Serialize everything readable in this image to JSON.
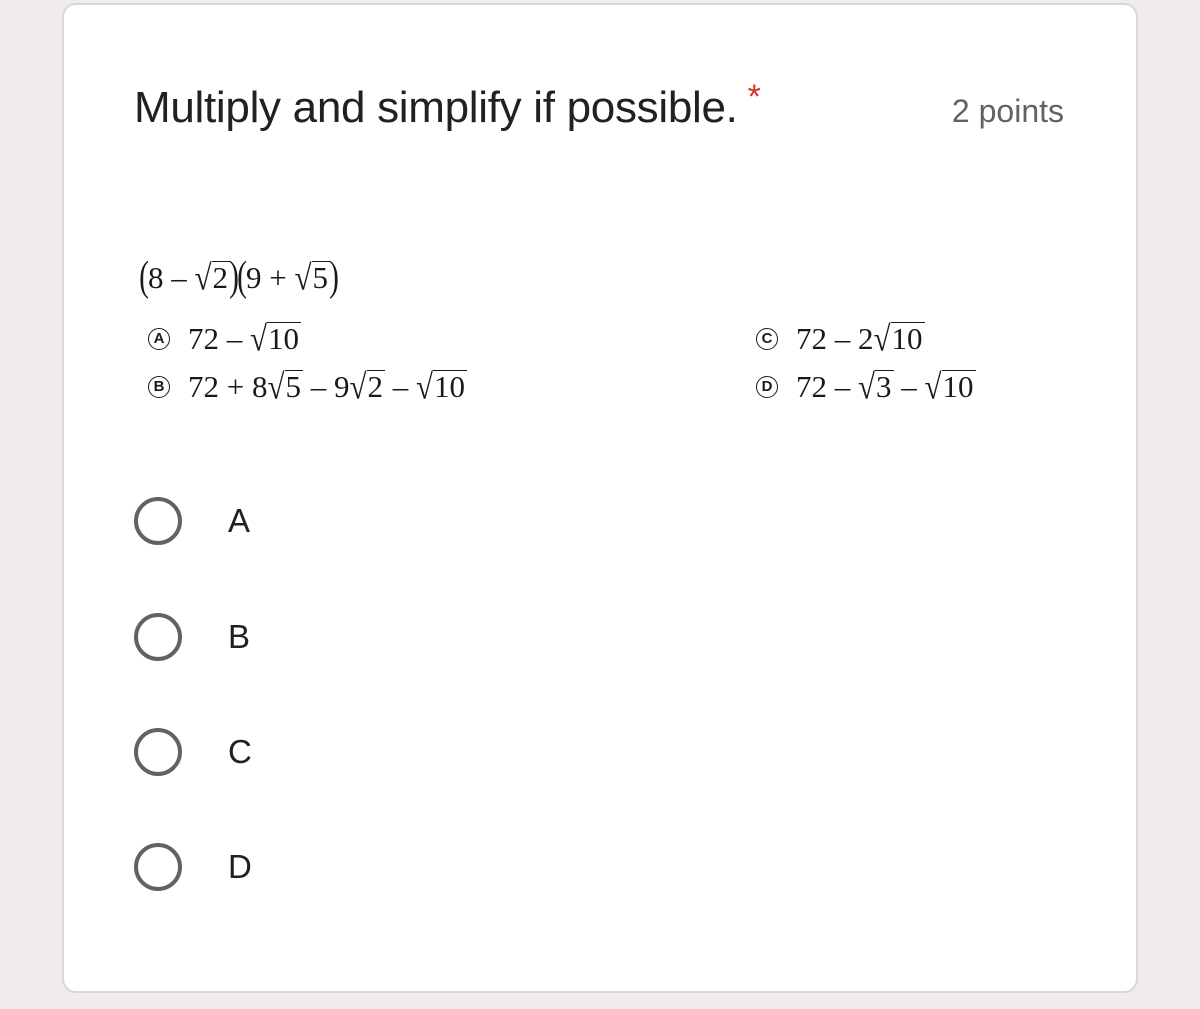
{
  "question": {
    "title": "Multiply and simplify if possible.",
    "required_marker": "*",
    "points": "2 points"
  },
  "problem": {
    "p1_a": "8",
    "p1_op": "–",
    "p1_root": "2",
    "p2_a": "9",
    "p2_op": "+",
    "p2_root": "5"
  },
  "choices": [
    {
      "letter": "A",
      "t1": "72 –",
      "r1": "10"
    },
    {
      "letter": "B",
      "t1": "72 + 8",
      "r1": "5",
      "t2": "– 9",
      "r2": "2",
      "t3": "–",
      "r3": "10"
    },
    {
      "letter": "C",
      "t1": "72 – 2",
      "r1": "10"
    },
    {
      "letter": "D",
      "t1": "72 –",
      "r1": "3",
      "t2": "–",
      "r2": "10"
    }
  ],
  "options": [
    {
      "label": "A",
      "selected": false
    },
    {
      "label": "B",
      "selected": false
    },
    {
      "label": "C",
      "selected": false
    },
    {
      "label": "D",
      "selected": false
    }
  ],
  "colors": {
    "background": "#f1eceb",
    "card": "#ffffff",
    "required": "#d93025",
    "radio_border": "#5f6368"
  }
}
